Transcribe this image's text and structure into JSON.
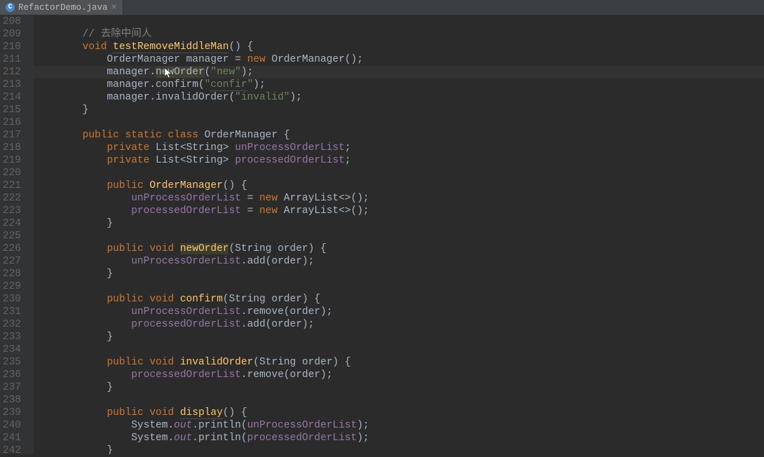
{
  "tab": {
    "icon_letter": "C",
    "filename": "RefactorDemo.java",
    "close_glyph": "×"
  },
  "lines": [
    {
      "n": 208,
      "tokens": [
        {
          "t": "",
          "c": ""
        }
      ]
    },
    {
      "n": 209,
      "tokens": [
        {
          "t": "    ",
          "c": ""
        },
        {
          "t": "// 去除中间人",
          "c": "cm"
        }
      ]
    },
    {
      "n": 210,
      "tokens": [
        {
          "t": "    ",
          "c": ""
        },
        {
          "t": "void",
          "c": "kw"
        },
        {
          "t": " ",
          "c": ""
        },
        {
          "t": "testRemoveMiddleMan",
          "c": "fn wul"
        },
        {
          "t": "() {",
          "c": ""
        }
      ]
    },
    {
      "n": 211,
      "tokens": [
        {
          "t": "        OrderManager manager = ",
          "c": ""
        },
        {
          "t": "new",
          "c": "kw"
        },
        {
          "t": " OrderManager();",
          "c": ""
        }
      ]
    },
    {
      "n": 212,
      "hl": true,
      "tokens": [
        {
          "t": "        manager.",
          "c": ""
        },
        {
          "t": "newOrder",
          "c": "id-hl"
        },
        {
          "t": "(",
          "c": ""
        },
        {
          "t": "\"new\"",
          "c": "str"
        },
        {
          "t": ");",
          "c": ""
        }
      ]
    },
    {
      "n": 213,
      "tokens": [
        {
          "t": "        manager.confirm(",
          "c": ""
        },
        {
          "t": "\"",
          "c": "str"
        },
        {
          "t": "confir",
          "c": "str wul"
        },
        {
          "t": "\"",
          "c": "str"
        },
        {
          "t": ");",
          "c": ""
        }
      ]
    },
    {
      "n": 214,
      "tokens": [
        {
          "t": "        manager.invalidOrder(",
          "c": ""
        },
        {
          "t": "\"invalid\"",
          "c": "str"
        },
        {
          "t": ");",
          "c": ""
        }
      ]
    },
    {
      "n": 215,
      "tokens": [
        {
          "t": "    }",
          "c": ""
        }
      ]
    },
    {
      "n": 216,
      "tokens": [
        {
          "t": "",
          "c": ""
        }
      ]
    },
    {
      "n": 217,
      "tokens": [
        {
          "t": "    ",
          "c": ""
        },
        {
          "t": "public static class",
          "c": "kw"
        },
        {
          "t": " OrderManager {",
          "c": ""
        }
      ]
    },
    {
      "n": 218,
      "tokens": [
        {
          "t": "        ",
          "c": ""
        },
        {
          "t": "private",
          "c": "kw"
        },
        {
          "t": " List<String> ",
          "c": ""
        },
        {
          "t": "unProcessOrderList",
          "c": "fld"
        },
        {
          "t": ";",
          "c": ""
        }
      ]
    },
    {
      "n": 219,
      "tokens": [
        {
          "t": "        ",
          "c": ""
        },
        {
          "t": "private",
          "c": "kw"
        },
        {
          "t": " List<String> ",
          "c": ""
        },
        {
          "t": "processedOrderList",
          "c": "fld"
        },
        {
          "t": ";",
          "c": ""
        }
      ]
    },
    {
      "n": 220,
      "tokens": [
        {
          "t": "",
          "c": ""
        }
      ]
    },
    {
      "n": 221,
      "tokens": [
        {
          "t": "        ",
          "c": ""
        },
        {
          "t": "public",
          "c": "kw"
        },
        {
          "t": " ",
          "c": ""
        },
        {
          "t": "OrderManager",
          "c": "fn"
        },
        {
          "t": "() {",
          "c": ""
        }
      ]
    },
    {
      "n": 222,
      "tokens": [
        {
          "t": "            ",
          "c": ""
        },
        {
          "t": "unProcessOrderList",
          "c": "fld"
        },
        {
          "t": " = ",
          "c": ""
        },
        {
          "t": "new",
          "c": "kw"
        },
        {
          "t": " ArrayList<>();",
          "c": ""
        }
      ]
    },
    {
      "n": 223,
      "tokens": [
        {
          "t": "            ",
          "c": ""
        },
        {
          "t": "processedOrderList",
          "c": "fld"
        },
        {
          "t": " = ",
          "c": ""
        },
        {
          "t": "new",
          "c": "kw"
        },
        {
          "t": " ArrayList<>();",
          "c": ""
        }
      ]
    },
    {
      "n": 224,
      "tokens": [
        {
          "t": "        }",
          "c": ""
        }
      ]
    },
    {
      "n": 225,
      "tokens": [
        {
          "t": "",
          "c": ""
        }
      ]
    },
    {
      "n": 226,
      "tokens": [
        {
          "t": "        ",
          "c": ""
        },
        {
          "t": "public void",
          "c": "kw"
        },
        {
          "t": " ",
          "c": ""
        },
        {
          "t": "newOrder",
          "c": "fn id-hl"
        },
        {
          "t": "(String order) {",
          "c": ""
        }
      ]
    },
    {
      "n": 227,
      "tokens": [
        {
          "t": "            ",
          "c": ""
        },
        {
          "t": "unProcessOrderList",
          "c": "fld"
        },
        {
          "t": ".add(order);",
          "c": ""
        }
      ]
    },
    {
      "n": 228,
      "tokens": [
        {
          "t": "        }",
          "c": ""
        }
      ]
    },
    {
      "n": 229,
      "tokens": [
        {
          "t": "",
          "c": ""
        }
      ]
    },
    {
      "n": 230,
      "tokens": [
        {
          "t": "        ",
          "c": ""
        },
        {
          "t": "public void",
          "c": "kw"
        },
        {
          "t": " ",
          "c": ""
        },
        {
          "t": "confirm",
          "c": "fn"
        },
        {
          "t": "(String order) {",
          "c": ""
        }
      ]
    },
    {
      "n": 231,
      "tokens": [
        {
          "t": "            ",
          "c": ""
        },
        {
          "t": "unProcessOrderList",
          "c": "fld"
        },
        {
          "t": ".remove(order);",
          "c": ""
        }
      ]
    },
    {
      "n": 232,
      "tokens": [
        {
          "t": "            ",
          "c": ""
        },
        {
          "t": "processedOrderList",
          "c": "fld"
        },
        {
          "t": ".add(order);",
          "c": ""
        }
      ]
    },
    {
      "n": 233,
      "tokens": [
        {
          "t": "        }",
          "c": ""
        }
      ]
    },
    {
      "n": 234,
      "tokens": [
        {
          "t": "",
          "c": ""
        }
      ]
    },
    {
      "n": 235,
      "tokens": [
        {
          "t": "        ",
          "c": ""
        },
        {
          "t": "public void",
          "c": "kw"
        },
        {
          "t": " ",
          "c": ""
        },
        {
          "t": "invalidOrder",
          "c": "fn"
        },
        {
          "t": "(String order) {",
          "c": ""
        }
      ]
    },
    {
      "n": 236,
      "tokens": [
        {
          "t": "            ",
          "c": ""
        },
        {
          "t": "processedOrderList",
          "c": "fld"
        },
        {
          "t": ".remove(order);",
          "c": ""
        }
      ]
    },
    {
      "n": 237,
      "tokens": [
        {
          "t": "        }",
          "c": ""
        }
      ]
    },
    {
      "n": 238,
      "tokens": [
        {
          "t": "",
          "c": ""
        }
      ]
    },
    {
      "n": 239,
      "tokens": [
        {
          "t": "        ",
          "c": ""
        },
        {
          "t": "public void",
          "c": "kw"
        },
        {
          "t": " ",
          "c": ""
        },
        {
          "t": "display",
          "c": "fn wul"
        },
        {
          "t": "() {",
          "c": ""
        }
      ]
    },
    {
      "n": 240,
      "tokens": [
        {
          "t": "            System.",
          "c": ""
        },
        {
          "t": "out",
          "c": "fld it"
        },
        {
          "t": ".println(",
          "c": ""
        },
        {
          "t": "unProcessOrderList",
          "c": "fld"
        },
        {
          "t": ");",
          "c": ""
        }
      ]
    },
    {
      "n": 241,
      "tokens": [
        {
          "t": "            System.",
          "c": ""
        },
        {
          "t": "out",
          "c": "fld it"
        },
        {
          "t": ".println(",
          "c": ""
        },
        {
          "t": "processedOrderList",
          "c": "fld"
        },
        {
          "t": ");",
          "c": ""
        }
      ]
    },
    {
      "n": 242,
      "tokens": [
        {
          "t": "        }",
          "c": ""
        }
      ]
    }
  ]
}
